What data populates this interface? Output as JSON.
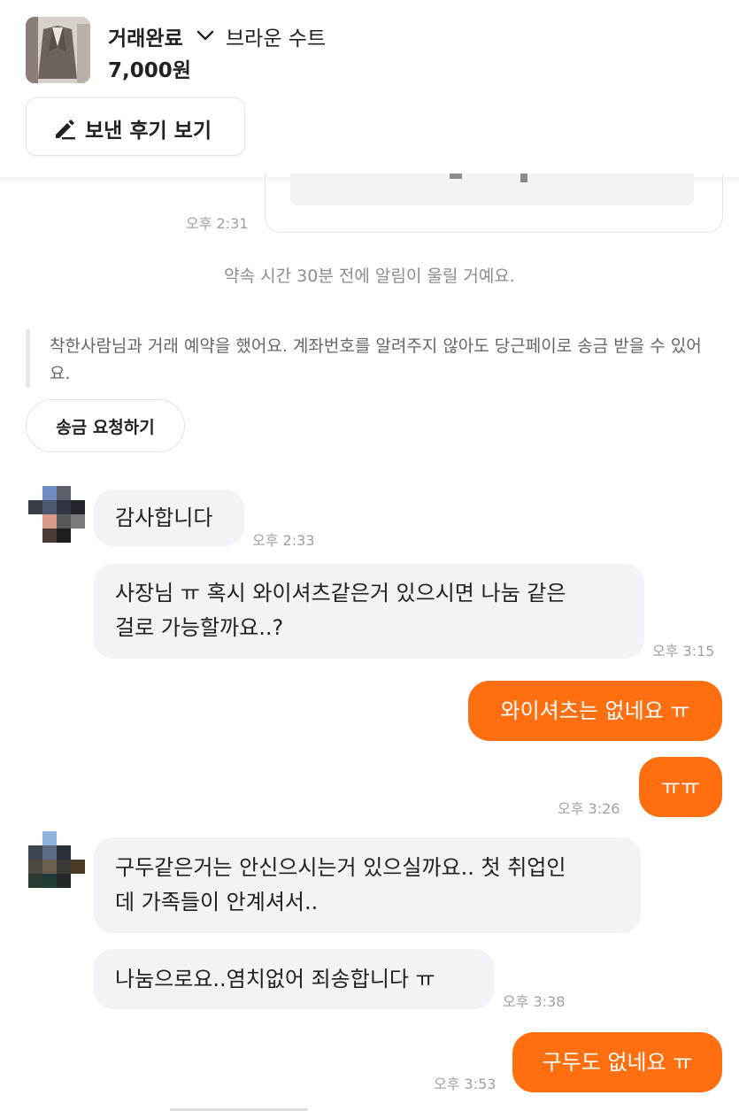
{
  "header": {
    "status_label": "거래완료",
    "product_name": "브라운 수트",
    "price": "7,000원",
    "review_button_label": "보낸 후기 보기"
  },
  "messages": {
    "card_time": "오후 2:31",
    "system_notice": "약속 시간 30분 전에 알림이 울릴 거예요.",
    "payment_notice": "착한사람님과 거래 예약을 했어요. 계좌번호를 알려주지 않아도 당근페이로 송금 받을 수 있어요.",
    "send_money_button": "송금 요청하기",
    "m1_text": "감사합니다",
    "m1_time": "오후 2:33",
    "m2_line1": "사장님 ㅠ 혹시 와이셔츠같은거 있으시면 나눔 같은",
    "m2_line2": "걸로 가능할까요..?",
    "m2_time": "오후 3:15",
    "m3_text": "와이셔츠는 없네요 ㅠ",
    "m4_text": "ㅠㅠ",
    "m4_time": "오후 3:26",
    "m5_line1": "구두같은거는 안신으시는거 있으실까요.. 첫 취업인",
    "m5_line2": "데 가족들이 안계셔서..",
    "m6_text": "나눔으로요..염치없어 죄송합니다 ㅠ",
    "m6_time": "오후 3:38",
    "m7_text": "구두도 없네요 ㅠ",
    "m7_time": "오후 3:53"
  },
  "icons": {
    "status_dropdown": "chevron-down-icon",
    "review_button": "pencil-icon",
    "avatar": "pixelated-avatar"
  },
  "colors": {
    "accent": "#ff6f0f",
    "incoming_bubble": "#f2f3f6",
    "time_text": "#a0a0a0"
  }
}
